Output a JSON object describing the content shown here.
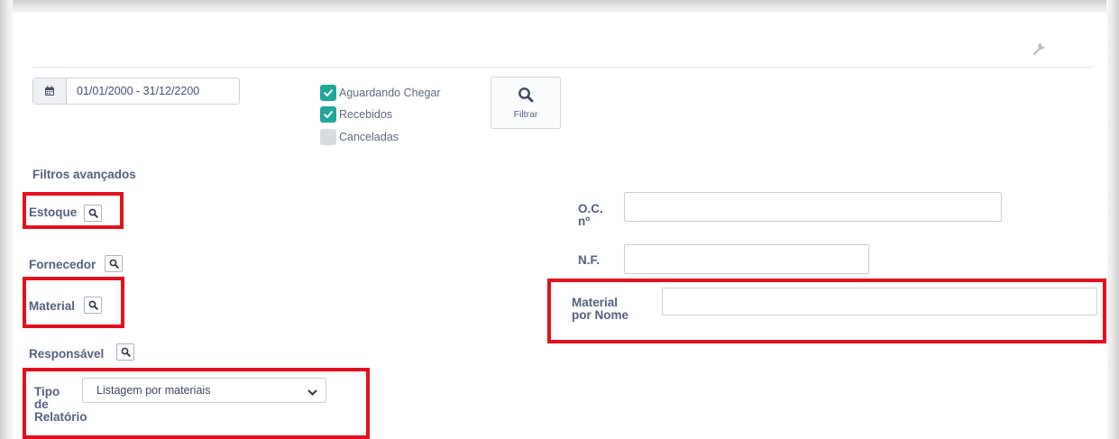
{
  "toolbar": {
    "settings_icon": "wrench-icon"
  },
  "date_range": {
    "icon": "calendar-icon",
    "value": "01/01/2000 - 31/12/2200"
  },
  "status_filters": [
    {
      "label": "Aguardando Chegar",
      "checked": true
    },
    {
      "label": "Recebidos",
      "checked": true
    },
    {
      "label": "Canceladas",
      "checked": false
    }
  ],
  "filter_button": {
    "label": "Filtrar",
    "icon": "search-icon"
  },
  "advanced": {
    "title": "Filtros avançados",
    "estoque_label": "Estoque",
    "fornecedor_label": "Fornecedor",
    "material_label": "Material",
    "responsavel_label": "Responsável",
    "tipo_relatorio_label_l1": "Tipo",
    "tipo_relatorio_label_l2": "de",
    "tipo_relatorio_label_l3": "Relatório",
    "tipo_relatorio_value": "Listagem por materiais",
    "oc_label_l1": "O.C.",
    "oc_label_l2": "nº",
    "oc_value": "",
    "nf_label": "N.F.",
    "nf_value": "",
    "material_nome_label_l1": "Material",
    "material_nome_label_l2": "por Nome",
    "material_nome_value": ""
  },
  "colors": {
    "highlight": "#e3101c",
    "checkbox_checked": "#1fa79a",
    "checkbox_unchecked": "#d8dbe0",
    "label_text": "#556080"
  }
}
